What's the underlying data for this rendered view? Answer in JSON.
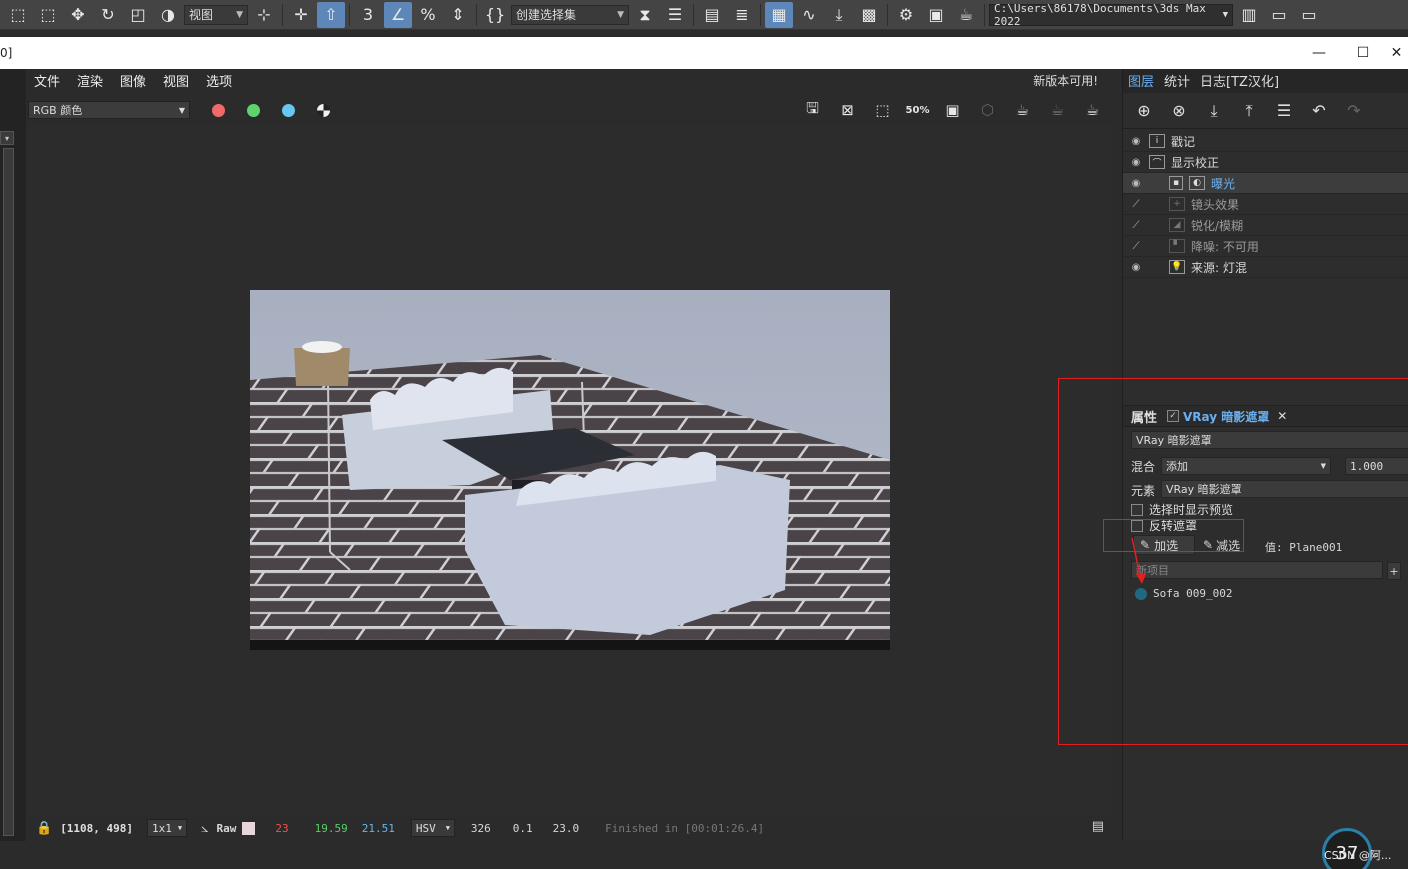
{
  "max_toolbar": {
    "view_dropdown": "视图",
    "selection_set": "创建选择集",
    "path": "C:\\Users\\86178\\Documents\\3ds Max 2022"
  },
  "vfb": {
    "title_char": "0]",
    "menu": [
      "文件",
      "渲染",
      "图像",
      "视图",
      "选项"
    ],
    "update_notice": "新版本可用!",
    "channel": "RGB 颜色",
    "dot_colors": [
      "#f06a6a",
      "#5dd56b",
      "#68c6f2",
      "#f2f2f2"
    ]
  },
  "statusbar": {
    "coords": "[1108, 498]",
    "zoom": "1x1",
    "raw": "Raw",
    "r": "23",
    "g": "19.59",
    "b": "21.51",
    "mode": "HSV",
    "h": "326",
    "s": "0.1",
    "v": "23.0",
    "finished": "Finished in [00:01:26.4]"
  },
  "right_panel": {
    "tabs": [
      "图层",
      "统计",
      "日志[TZ汉化]"
    ],
    "layers": [
      {
        "label": "戳记",
        "dim": false,
        "selected": false,
        "indent": 0,
        "visible": true
      },
      {
        "label": "显示校正",
        "dim": false,
        "selected": false,
        "indent": 0,
        "visible": true
      },
      {
        "label": "曝光",
        "dim": false,
        "selected": true,
        "indent": 1,
        "visible": true
      },
      {
        "label": "镜头效果",
        "dim": true,
        "selected": false,
        "indent": 1,
        "visible": false
      },
      {
        "label": "锐化/模糊",
        "dim": true,
        "selected": false,
        "indent": 1,
        "visible": false
      },
      {
        "label": "降噪: 不可用",
        "dim": true,
        "selected": false,
        "indent": 1,
        "visible": false
      },
      {
        "label": "来源: 灯混",
        "dim": false,
        "selected": false,
        "indent": 1,
        "visible": true
      }
    ],
    "props": {
      "header": "属性",
      "tab": "VRay 暗影遮罩",
      "name_field": "VRay 暗影遮罩",
      "blend_label": "混合",
      "blend_value": "添加",
      "blend_amount": "1.000",
      "element_label": "元素",
      "element_value": "VRay 暗影遮罩",
      "show_preview": "选择时显示预览",
      "invert_mask": "反转遮罩",
      "add_btn": "加选",
      "sub_btn": "减选",
      "value_text": "值: Plane001",
      "new_item_placeholder": "新项目",
      "item": "Sofa 009_002"
    }
  },
  "overlay": {
    "percent": "37",
    "watermark": "CSDN @阿..."
  }
}
